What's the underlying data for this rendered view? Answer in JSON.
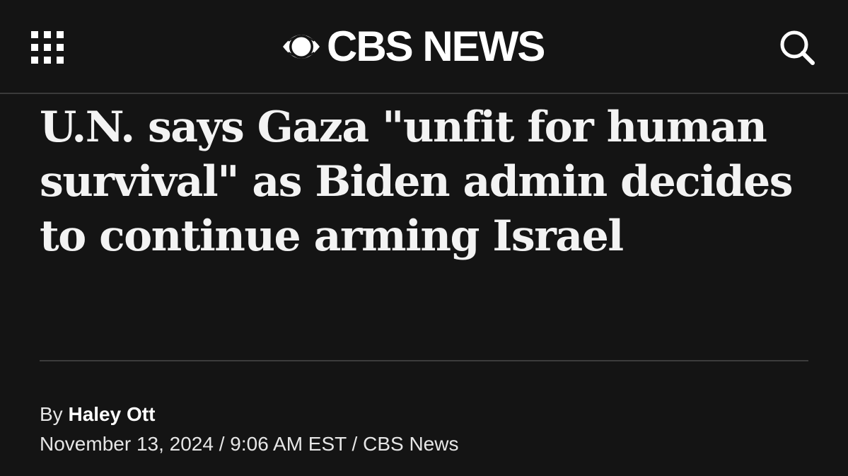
{
  "header": {
    "menu_icon": "grid-menu-icon",
    "logo_icon": "cbs-eye-icon",
    "logo_text": "CBS NEWS",
    "search_icon": "search-icon"
  },
  "article": {
    "headline": "U.N. says Gaza \"unfit for human survival\" as Biden admin decides to continue arming Israel",
    "byline_prefix": "By ",
    "author": "Haley Ott",
    "date": "November 13, 2024",
    "separator": " / ",
    "time": "9:06 AM EST",
    "source": "CBS News"
  }
}
